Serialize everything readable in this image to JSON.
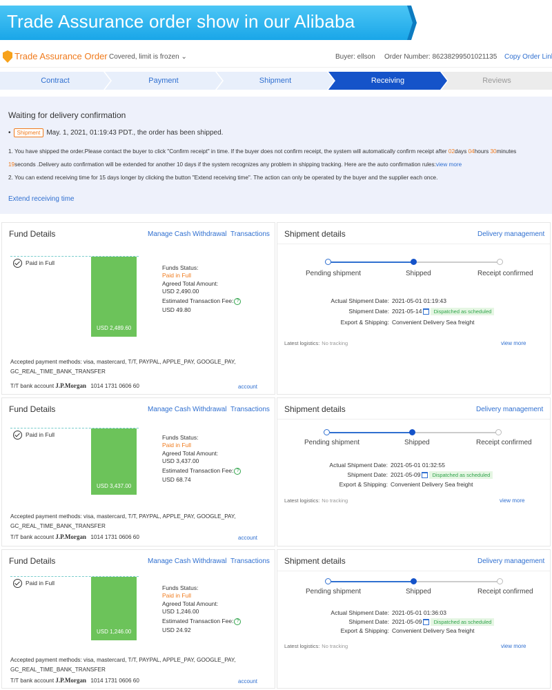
{
  "banner": {
    "title": "Trade Assurance order show in our Alibaba"
  },
  "order": {
    "title": "Trade Assurance Order",
    "covered": "Covered, limit is frozen ⌄",
    "buyer": "Buyer: ellson",
    "order_number": "Order Number: 86238299501021135",
    "copy_link": "Copy Order Link"
  },
  "steps": [
    {
      "label": "Contract",
      "state": "done"
    },
    {
      "label": "Payment",
      "state": "done"
    },
    {
      "label": "Shipment",
      "state": "done"
    },
    {
      "label": "Receiving",
      "state": "active"
    },
    {
      "label": "Reviews",
      "state": "future"
    }
  ],
  "waiting": {
    "title": "Waiting for delivery confirmation",
    "ship_tag": "Shipment",
    "ship_text": "May. 1, 2021, 01:19:43 PDT., the order has been shipped.",
    "note1_a": "1. You have shipped the order.Please contact the buyer to click \"Confirm receipt\" in time. If the buyer does not confirm receipt, the system will automatically confirm receipt after ",
    "note1_days": "02",
    "note1_days_u": "days ",
    "note1_hours": "04",
    "note1_hours_u": "hours ",
    "note1_min": "30",
    "note1_min_u": "minutes",
    "note1_sec": "19",
    "note1_b": "seconds .Delivery auto confirmation will be extended for another 10 days if the system recognizes any problem in shipping tracking. Here are the auto confirmation rules:",
    "note1_link": "view more",
    "note2": "2. You can extend receiving time for 15 days longer by clicking the button \"Extend receiving time\". The action can only be operated by the buyer and the supplier each once.",
    "extend": "Extend receiving time"
  },
  "labels": {
    "fund_details": "Fund Details",
    "manage_cash": "Manage Cash Withdrawal",
    "transactions": "Transactions",
    "shipment_details": "Shipment details",
    "delivery_mgmt": "Delivery management",
    "paid_in_full": "Paid in Full",
    "funds_status": "Funds Status:",
    "agreed_total": "Agreed Total Amount:",
    "est_fee": "Estimated Transaction Fee:",
    "q": "?",
    "pay_methods": "Accepted payment methods: visa, mastercard, T/T, PAYPAL, APPLE_PAY, GOOGLE_PAY, GC_REAL_TIME_BANK_TRANSFER",
    "bank_prefix": "T/T bank account",
    "bank_name": "J.P.Morgan",
    "bank_number": "1014 1731 0606 60",
    "account": "account",
    "pending": "Pending shipment",
    "shipped": "Shipped",
    "receipt": "Receipt confirmed",
    "actual_ship": "Actual Shipment Date:",
    "ship_date": "Shipment Date:",
    "dispatched": "Dispatched as scheduled",
    "export": "Export & Shipping:",
    "export_val": "Convenient Delivery Sea freight",
    "latest": "Latest logistics:",
    "no_tracking": "No tracking",
    "view_more": "view more"
  },
  "orders": [
    {
      "bar_value": "USD 2,489.60",
      "funds_status": "Paid in Full",
      "agreed_total": "USD 2,490.00",
      "fee": "USD 49.80",
      "actual_ship": "2021-05-01 01:19:43",
      "ship_date": "2021-05-14"
    },
    {
      "bar_value": "USD 3,437.00",
      "funds_status": "Paid in Full",
      "agreed_total": "USD 3,437.00",
      "fee": "USD 68.74",
      "actual_ship": "2021-05-01 01:32:55",
      "ship_date": "2021-05-09"
    },
    {
      "bar_value": "USD 1,246.00",
      "funds_status": "Paid in Full",
      "agreed_total": "USD 1,246.00",
      "fee": "USD 24.92",
      "actual_ship": "2021-05-01 01:36:03",
      "ship_date": "2021-05-09"
    }
  ],
  "colors": {
    "accent": "#1553c9",
    "link": "#2f6fd0",
    "orange": "#f07a1b",
    "green": "#6cc35a",
    "banner": "#1aa6e8"
  }
}
